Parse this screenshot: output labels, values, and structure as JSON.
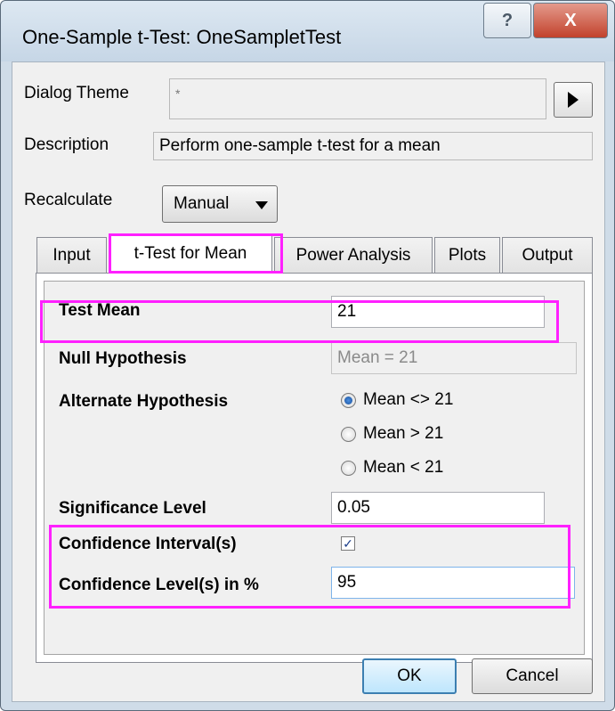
{
  "window": {
    "title": "One-Sample t-Test: OneSampletTest",
    "help_label": "?",
    "close_label": "X"
  },
  "dialog_theme": {
    "label": "Dialog Theme",
    "value": "*"
  },
  "description": {
    "label": "Description",
    "value": "Perform one-sample t-test for a mean"
  },
  "recalculate": {
    "label": "Recalculate",
    "value": "Manual"
  },
  "tabs": [
    {
      "label": "Input"
    },
    {
      "label": "t-Test for Mean"
    },
    {
      "label": "Power Analysis"
    },
    {
      "label": "Plots"
    },
    {
      "label": "Output"
    }
  ],
  "active_tab": "t-Test for Mean",
  "panel": {
    "test_mean": {
      "label": "Test Mean",
      "value": "21"
    },
    "null_hypothesis": {
      "label": "Null Hypothesis",
      "value": "Mean = 21"
    },
    "alternate_hypothesis": {
      "label": "Alternate Hypothesis",
      "options": [
        "Mean <> 21",
        "Mean > 21",
        "Mean < 21"
      ],
      "selected": "Mean <> 21"
    },
    "significance_level": {
      "label": "Significance Level",
      "value": "0.05"
    },
    "confidence_intervals": {
      "label": "Confidence Interval(s)",
      "checked": true
    },
    "confidence_levels": {
      "label": "Confidence Level(s) in %",
      "value": "95"
    }
  },
  "buttons": {
    "ok": "OK",
    "cancel": "Cancel"
  },
  "colors": {
    "highlight": "#ff20ff",
    "accent": "#3c7fb1"
  }
}
